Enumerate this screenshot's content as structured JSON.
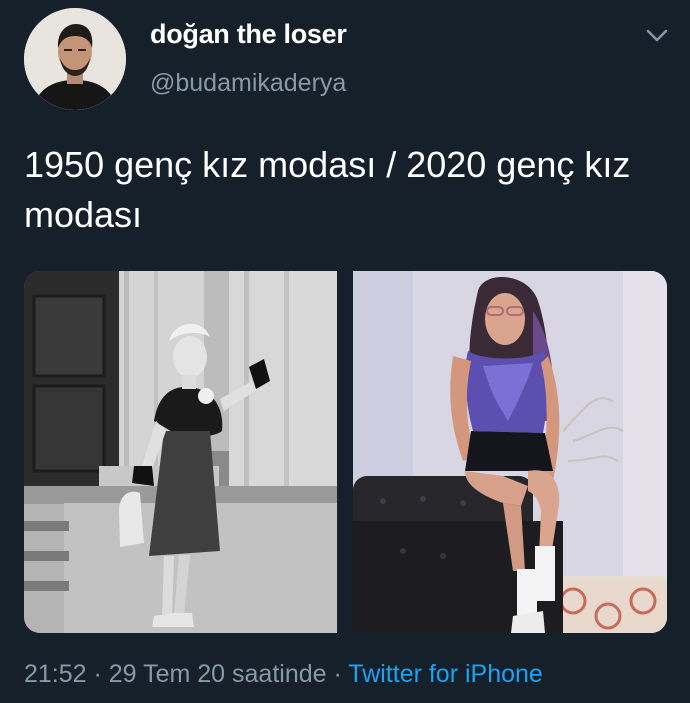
{
  "tweet": {
    "display_name": "doğan the loser",
    "handle": "@budamikaderya",
    "text": "1950 genç kız modası / 2020 genç kız modası",
    "media": [
      {
        "type": "photo",
        "style": "black-and-white"
      },
      {
        "type": "photo",
        "style": "color"
      }
    ],
    "time": "21:52",
    "separator": " · ",
    "date": "29 Tem 20 saatinde",
    "source": "Twitter for iPhone"
  },
  "icons": {
    "menu": "chevron-down-icon"
  },
  "colors": {
    "background": "#15202b",
    "primary_text": "#ffffff",
    "secondary_text": "#8899a6",
    "link": "#1da1f2"
  }
}
